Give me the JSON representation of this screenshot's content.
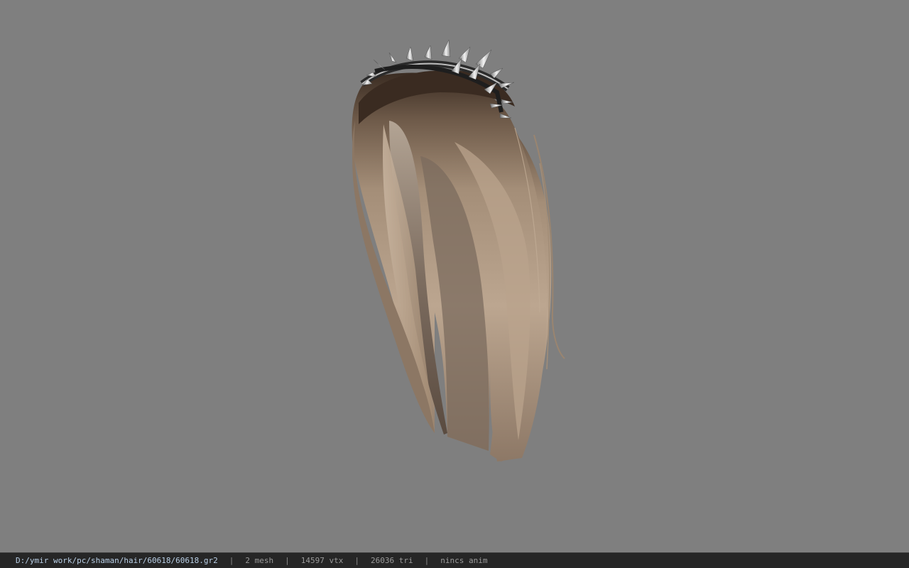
{
  "viewport": {
    "background_color": "#7f7f7f",
    "model_name": "spiked-headband-long-hair"
  },
  "statusbar": {
    "file_path": "D:/ymir work/pc/shaman/hair/60618/60618.gr2",
    "separator": "|",
    "mesh_count": "2 mesh",
    "vertex_count": "14597 vtx",
    "triangle_count": "26036 tri",
    "anim_status": "nincs anim"
  }
}
